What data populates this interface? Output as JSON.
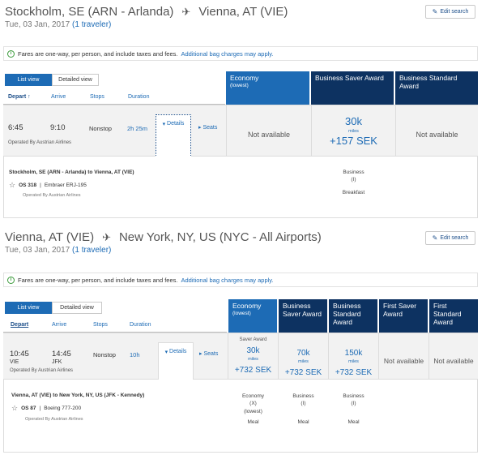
{
  "segments": [
    {
      "origin": "Stockholm, SE (ARN - Arlanda)",
      "destination": "Vienna, AT (VIE)",
      "date": "Tue, 03 Jan, 2017",
      "travelers": "(1 traveler)",
      "edit_label": "Edit search",
      "fare_note": "Fares are one-way, per person, and include taxes and fees.",
      "bag_link": "Additional bag charges may apply.",
      "view_list": "List view",
      "view_detailed": "Detailed view",
      "sort": {
        "depart": "Depart",
        "arrive": "Arrive",
        "stops": "Stops",
        "duration": "Duration"
      },
      "columns": [
        {
          "name": "Economy",
          "sub": "(lowest)"
        },
        {
          "name": "Business Saver Award"
        },
        {
          "name": "Business Standard Award"
        }
      ],
      "flight": {
        "depart": "6:45",
        "arrive": "9:10",
        "stops": "Nonstop",
        "duration": "2h 25m",
        "operator": "Operated By Austrian Airlines",
        "details_label": "Details",
        "seats_label": "Seats"
      },
      "prices": [
        {
          "na": "Not available"
        },
        {
          "miles": "30k",
          "miles_unit": "miles",
          "sek": "+157 SEK"
        },
        {
          "na": "Not available"
        }
      ],
      "detail": {
        "route": "Stockholm, SE (ARN - Arlanda) to Vienna, AT (VIE)",
        "flight_no": "OS 318",
        "aircraft": "Embraer ERJ-195",
        "operator": "Operated By Austrian Airlines",
        "cabin": {
          "class": "Business",
          "code": "(I)",
          "meal": "Breakfast"
        }
      }
    },
    {
      "origin": "Vienna, AT (VIE)",
      "destination": "New York, NY, US (NYC - All Airports)",
      "date": "Tue, 03 Jan, 2017",
      "travelers": "(1 traveler)",
      "edit_label": "Edit search",
      "fare_note": "Fares are one-way, per person, and include taxes and fees.",
      "bag_link": "Additional bag charges may apply.",
      "view_list": "List view",
      "view_detailed": "Detailed view",
      "sort": {
        "depart": "Depart",
        "arrive": "Arrive",
        "stops": "Stops",
        "duration": "Duration"
      },
      "columns": [
        {
          "name": "Economy",
          "sub": "(lowest)"
        },
        {
          "name": "Business Saver Award"
        },
        {
          "name": "Business Standard Award"
        },
        {
          "name": "First Saver Award"
        },
        {
          "name": "First Standard Award"
        }
      ],
      "flight": {
        "depart": "10:45",
        "depart_code": "VIE",
        "arrive": "14:45",
        "arrive_code": "JFK",
        "stops": "Nonstop",
        "duration": "10h",
        "operator": "Operated By Austrian Airlines",
        "details_label": "Details",
        "seats_label": "Seats"
      },
      "prices": [
        {
          "tag": "Saver Award",
          "miles": "30k",
          "miles_unit": "miles",
          "sek": "+732 SEK"
        },
        {
          "miles": "70k",
          "miles_unit": "miles",
          "sek": "+732 SEK"
        },
        {
          "miles": "150k",
          "miles_unit": "miles",
          "sek": "+732 SEK"
        },
        {
          "na": "Not available"
        },
        {
          "na": "Not available"
        }
      ],
      "detail": {
        "route": "Vienna, AT (VIE) to New York, NY, US (JFK - Kennedy)",
        "flight_no": "OS 87",
        "aircraft": "Boeing 777-200",
        "operator": "Operated By Austrian Airlines",
        "cabins": [
          {
            "class": "Economy",
            "code": "(X)",
            "extra": "(lowest)",
            "meal": "Meal"
          },
          {
            "class": "Business",
            "code": "(I)",
            "meal": "Meal"
          },
          {
            "class": "Business",
            "code": "(I)",
            "meal": "Meal"
          }
        ]
      }
    }
  ],
  "colors": {
    "economy": "#1d6bb5",
    "award": "#0d3261",
    "link": "#1d6bb5",
    "info": "#3a9a3a"
  }
}
